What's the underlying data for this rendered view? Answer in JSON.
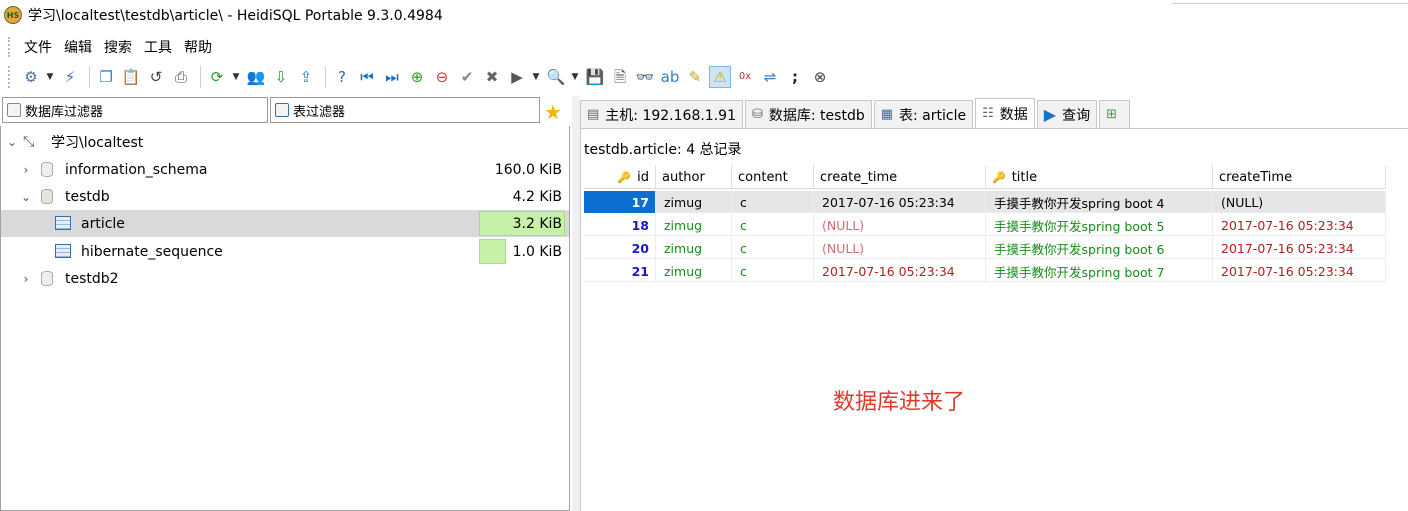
{
  "window": {
    "title": "学习\\localtest\\testdb\\article\\ - HeidiSQL Portable 9.3.0.4984",
    "logo_text": "HS"
  },
  "menu": [
    "文件",
    "编辑",
    "搜索",
    "工具",
    "帮助"
  ],
  "left": {
    "db_filter_placeholder": "数据库过滤器",
    "table_filter_placeholder": "表过滤器",
    "tree": {
      "root": "学习\\localtest",
      "items": [
        {
          "label": "information_schema",
          "size": "160.0 KiB"
        },
        {
          "label": "testdb",
          "size": "4.2 KiB"
        },
        {
          "label": "article",
          "size": "3.2 KiB",
          "fill": 1.0
        },
        {
          "label": "hibernate_sequence",
          "size": "1.0 KiB",
          "fill": 0.31
        },
        {
          "label": "testdb2",
          "size": ""
        }
      ]
    }
  },
  "tabs": {
    "host": "主机: 192.168.1.91",
    "database": "数据库: testdb",
    "table": "表: article",
    "data": "数据",
    "query": "查询"
  },
  "grid": {
    "record_count": "testdb.article: 4 总记录",
    "columns": [
      "id",
      "author",
      "content",
      "create_time",
      "title",
      "createTime"
    ],
    "rows": [
      {
        "id": "17",
        "author": "zimug",
        "content": "c",
        "create_time": "2017-07-16 05:23:34",
        "title": "手摸手教你开发spring boot 4",
        "createTime": "(NULL)"
      },
      {
        "id": "18",
        "author": "zimug",
        "content": "c",
        "create_time": "(NULL)",
        "title": "手摸手教你开发spring boot 5",
        "createTime": "2017-07-16 05:23:34"
      },
      {
        "id": "20",
        "author": "zimug",
        "content": "c",
        "create_time": "(NULL)",
        "title": "手摸手教你开发spring boot 6",
        "createTime": "2017-07-16 05:23:34"
      },
      {
        "id": "21",
        "author": "zimug",
        "content": "c",
        "create_time": "2017-07-16 05:23:34",
        "title": "手摸手教你开发spring boot 7",
        "createTime": "2017-07-16 05:23:34"
      }
    ]
  },
  "annotation": "数据库进来了",
  "colors": {
    "text_green": "#1a8a1a",
    "date_red": "#b02020",
    "null_red": "#c87070",
    "id_blue": "#1818c8",
    "selection": "#0a6fd0"
  }
}
